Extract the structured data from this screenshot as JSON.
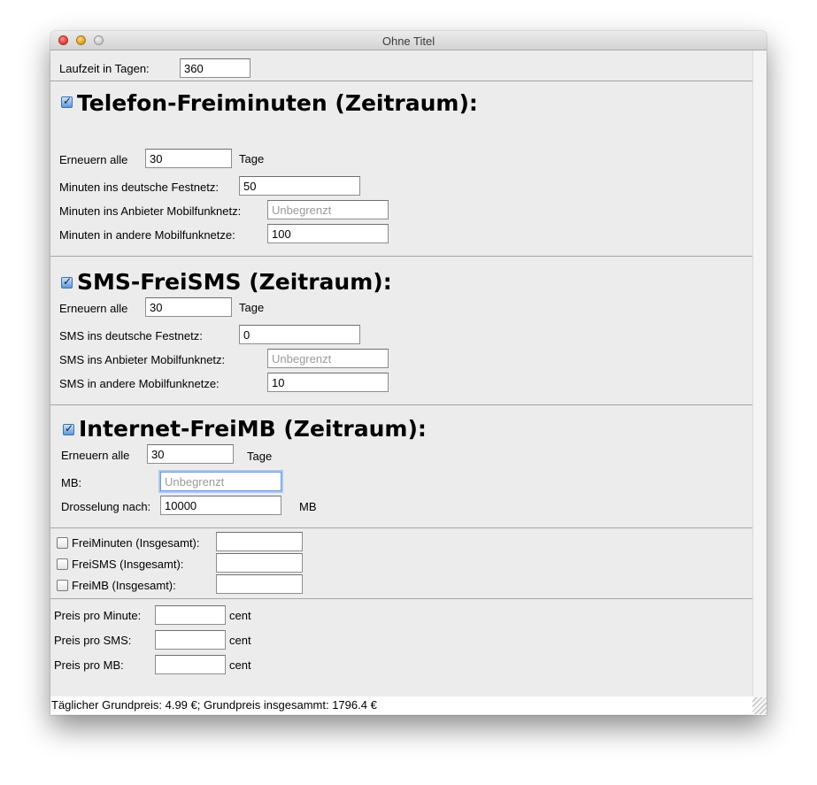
{
  "window": {
    "title": "Ohne Titel"
  },
  "laufzeit": {
    "label": "Laufzeit in Tagen:",
    "value": "360"
  },
  "telefon": {
    "checked": true,
    "heading": "Telefon-Freiminuten (Zeitraum):",
    "renew_label": "Erneuern alle",
    "renew_value": "30",
    "renew_unit": "Tage",
    "rows": [
      {
        "label": "Minuten ins deutsche Festnetz:",
        "value": "50",
        "placeholder": ""
      },
      {
        "label": "Minuten ins Anbieter Mobilfunknetz:",
        "value": "",
        "placeholder": "Unbegrenzt"
      },
      {
        "label": "Minuten in andere Mobilfunknetze:",
        "value": "100",
        "placeholder": ""
      }
    ]
  },
  "sms": {
    "checked": true,
    "heading": "SMS-FreiSMS (Zeitraum):",
    "renew_label": "Erneuern alle",
    "renew_value": "30",
    "renew_unit": "Tage",
    "rows": [
      {
        "label": "SMS ins deutsche Festnetz:",
        "value": "0",
        "placeholder": ""
      },
      {
        "label": "SMS ins Anbieter Mobilfunknetz:",
        "value": "",
        "placeholder": "Unbegrenzt"
      },
      {
        "label": "SMS in andere Mobilfunknetze:",
        "value": "10",
        "placeholder": ""
      }
    ]
  },
  "internet": {
    "checked": true,
    "heading": "Internet-FreiMB (Zeitraum):",
    "renew_label": "Erneuern alle",
    "renew_value": "30",
    "renew_unit": "Tage",
    "mb_label": "MB:",
    "mb_value": "",
    "mb_placeholder": "Unbegrenzt",
    "throttle_label": "Drosselung nach:",
    "throttle_value": "10000",
    "throttle_unit": "MB"
  },
  "totals": [
    {
      "label": "FreiMinuten (Insgesamt):",
      "value": "",
      "checked": false
    },
    {
      "label": "FreiSMS (Insgesamt):",
      "value": "",
      "checked": false
    },
    {
      "label": "FreiMB (Insgesamt):",
      "value": "",
      "checked": false
    }
  ],
  "prices": [
    {
      "label": "Preis pro Minute:",
      "value": "",
      "unit": "cent"
    },
    {
      "label": "Preis pro SMS:",
      "value": "",
      "unit": "cent"
    },
    {
      "label": "Preis pro MB:",
      "value": "",
      "unit": "cent"
    }
  ],
  "status": {
    "text": "Täglicher Grundpreis: 4.99 €; Grundpreis insgesammt: 1796.4 €"
  },
  "colors": {
    "window_bg": "#ececec",
    "focus_ring": "#a9c8f0",
    "separator": "#a6a6a6"
  }
}
